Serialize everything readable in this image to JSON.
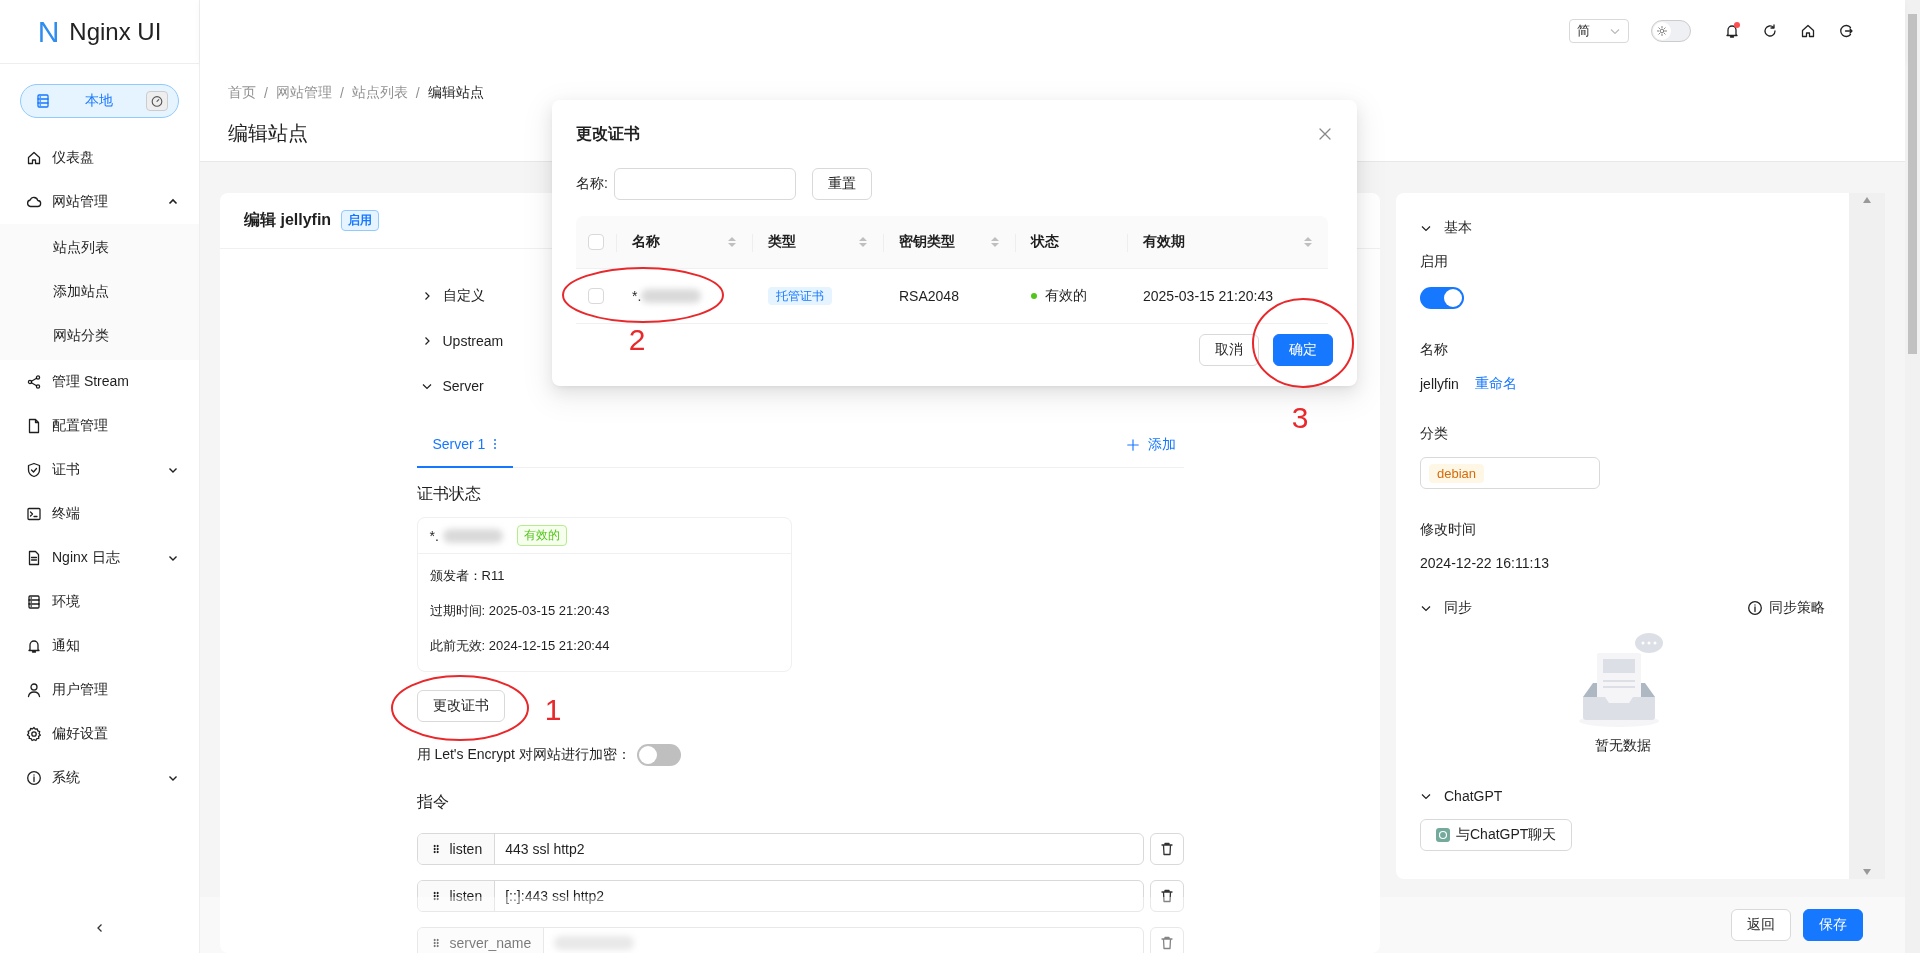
{
  "app": {
    "logo_letter": "N",
    "name": "Nginx UI"
  },
  "node_switch": {
    "label": "本地",
    "selected": true
  },
  "sidebar": {
    "items": [
      {
        "label": "仪表盘"
      },
      {
        "label": "网站管理",
        "expanded": true,
        "children": [
          {
            "label": "站点列表"
          },
          {
            "label": "添加站点"
          },
          {
            "label": "网站分类"
          }
        ]
      },
      {
        "label": "管理 Stream"
      },
      {
        "label": "配置管理"
      },
      {
        "label": "证书",
        "expanded": false
      },
      {
        "label": "终端"
      },
      {
        "label": "Nginx 日志",
        "expanded": false
      },
      {
        "label": "环境"
      },
      {
        "label": "通知"
      },
      {
        "label": "用户管理"
      },
      {
        "label": "偏好设置"
      },
      {
        "label": "系统",
        "expanded": false
      }
    ]
  },
  "header": {
    "language": "简",
    "dark_mode": false,
    "unread_notifications": true
  },
  "breadcrumb": {
    "separator": "/",
    "items": [
      "首页",
      "网站管理",
      "站点列表",
      "编辑站点"
    ]
  },
  "page_title": "编辑站点",
  "editor": {
    "title": "编辑 jellyfin",
    "status_tag": "启用",
    "sections": [
      {
        "label": "自定义",
        "expanded": false
      },
      {
        "label": "Upstream",
        "expanded": false
      },
      {
        "label": "Server",
        "expanded": true
      }
    ],
    "server_tabs": [
      {
        "label": "Server 1",
        "selected": true
      }
    ],
    "add_label": "添加",
    "cert_heading": "证书状态",
    "cert": {
      "name": "*.",
      "status": "有效的",
      "details": [
        "颁发者：R11",
        "过期时间: 2025-03-15 21:20:43",
        "此前无效: 2024-12-15 21:20:44"
      ]
    },
    "change_cert_button": "更改证书",
    "letsencrypt": {
      "label": "用 Let's Encrypt 对网站进行加密：",
      "on": false
    },
    "directives_heading": "指令",
    "directives": [
      {
        "name": "listen",
        "value": "443 ssl http2"
      },
      {
        "name": "listen",
        "value": "[::]:443 ssl http2"
      },
      {
        "name": "server_name",
        "redacted": true
      }
    ]
  },
  "footer": {
    "buttons": [
      {
        "label": "返回",
        "kind": "default"
      },
      {
        "label": "保存",
        "kind": "primary"
      }
    ]
  },
  "side_panel": {
    "basic_heading": "基本",
    "basic_expanded": true,
    "enabled_label": "启用",
    "enabled": true,
    "name_label": "名称",
    "name": "jellyfin",
    "rename_link": "重命名",
    "category_label": "分类",
    "category": "debian",
    "modified_label": "修改时间",
    "modified": "2024-12-22 16:11:13",
    "sync_heading": "同步",
    "sync_expanded": true,
    "sync_policy": "同步策略",
    "sync_empty": "暂无数据",
    "chatgpt_heading": "ChatGPT",
    "chatgpt_expanded": true,
    "chatgpt_button": "与ChatGPT聊天"
  },
  "modal": {
    "title": "更改证书",
    "filter_label": "名称:",
    "reset_button": "重置",
    "all_checked": false,
    "columns": [
      {
        "label": "名称",
        "sortable": true
      },
      {
        "label": "类型",
        "sortable": true
      },
      {
        "label": "密钥类型",
        "sortable": true
      },
      {
        "label": "状态",
        "sortable": false
      },
      {
        "label": "有效期",
        "sortable": true
      }
    ],
    "rows": [
      {
        "checked": false,
        "name": "*.",
        "type": "托管证书",
        "key_type": "RSA2048",
        "status": "有效的",
        "color": "#52c41a",
        "expiry": "2025-03-15 21:20:43"
      }
    ],
    "cancel_button": "取消",
    "ok_button": "确定"
  },
  "annotations": [
    {
      "number": "1"
    },
    {
      "number": "2"
    },
    {
      "number": "3"
    }
  ]
}
